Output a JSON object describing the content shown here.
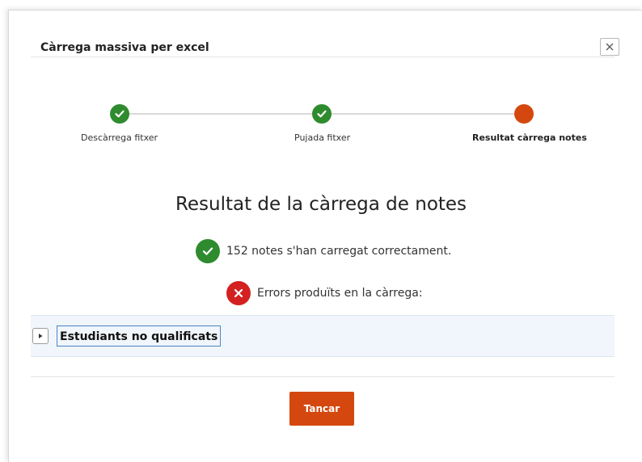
{
  "dialog": {
    "title": "Càrrega massiva per excel",
    "close_icon": "close-icon"
  },
  "stepper": {
    "steps": [
      {
        "label": "Descàrrega fitxer",
        "state": "done",
        "icon": "check-icon"
      },
      {
        "label": "Pujada fitxer",
        "state": "done",
        "icon": "check-icon"
      },
      {
        "label": "Resultat càrrega notes",
        "state": "current",
        "icon": "dot"
      }
    ]
  },
  "result": {
    "heading": "Resultat de la càrrega de notes",
    "success_text": "152 notes s'han carregat correctament.",
    "error_text": "Errors produïts en la càrrega:"
  },
  "accordion": {
    "title": "Estudiants no qualificats",
    "expanded": false
  },
  "footer": {
    "close_label": "Tancar"
  },
  "colors": {
    "accent": "#d4480f",
    "success": "#2e8b2e",
    "error": "#d42020",
    "accordion_bg": "#f0f6fb"
  }
}
